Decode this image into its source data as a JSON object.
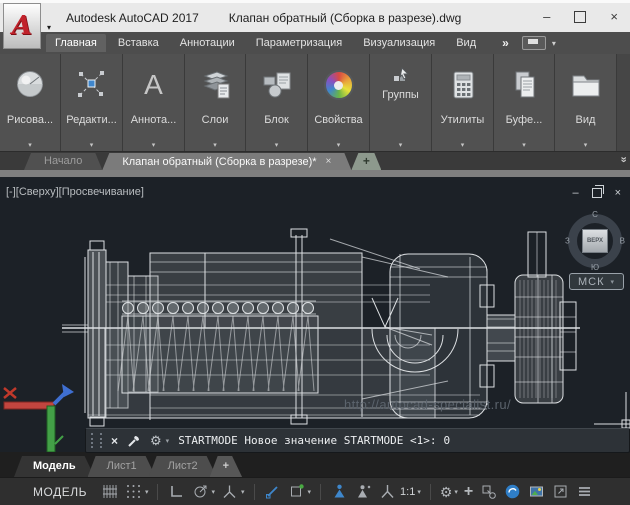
{
  "window": {
    "app_title": "Autodesk AutoCAD 2017",
    "doc_title": "Клапан обратный (Сборка в разрезе).dwg",
    "logo_letter": "A"
  },
  "glyphs": {
    "caret": "▾",
    "minimize": "–",
    "close": "×",
    "overflow": "»",
    "plus": "+",
    "gear": "⚙",
    "annotate_letter": "А",
    "chevrons": "»"
  },
  "ribbon": {
    "tabs": [
      {
        "label": "Главная",
        "active": true
      },
      {
        "label": "Вставка"
      },
      {
        "label": "Аннотации"
      },
      {
        "label": "Параметризация"
      },
      {
        "label": "Визуализация"
      },
      {
        "label": "Вид"
      }
    ],
    "panels": [
      {
        "label": "Рисова...",
        "icon": "draw-sphere-icon"
      },
      {
        "label": "Редакти...",
        "icon": "modify-icon"
      },
      {
        "label": "Аннота...",
        "icon": "annotation-letter-icon"
      },
      {
        "label": "Слои",
        "icon": "layers-icon"
      },
      {
        "label": "Блок",
        "icon": "block-icon"
      },
      {
        "label": "Свойства",
        "icon": "properties-colorwheel-icon"
      },
      {
        "label": "Группы",
        "icon": "groups-cursor-icon"
      },
      {
        "label": "Утилиты",
        "icon": "utilities-calculator-icon"
      },
      {
        "label": "Буфе...",
        "icon": "clipboard-icon"
      },
      {
        "label": "Вид",
        "icon": "view-folder-icon"
      }
    ]
  },
  "file_tabs": {
    "start_tab": "Начало",
    "active_tab": "Клапан обратный (Сборка в разрезе)*"
  },
  "viewport": {
    "control_minus": "[-]",
    "control_view": "[Сверху]",
    "control_style": "[Просвечивание]",
    "viewcube": {
      "north": "С",
      "east": "В",
      "south": "Ю",
      "west": "З",
      "top_label": "ВЕРХ"
    },
    "ucs_button_label": "МСК",
    "watermark": "http://autocad-specialist.ru/"
  },
  "command_line": {
    "prompt": "STARTMODE Новое значение STARTMODE <1>:",
    "value": "0"
  },
  "layout_tabs": {
    "model": "Модель",
    "sheet1": "Лист1",
    "sheet2": "Лист2",
    "add": "+"
  },
  "status_bar": {
    "model_label": "МОДЕЛЬ",
    "annotation_scale": "1:1"
  },
  "icons": {
    "grid-display-icon": "grid-lines",
    "snap-mode-icon": "dotted-grid",
    "ortho-mode-icon": "L-angle",
    "polar-tracking-icon": "circle-with-ray",
    "isometric-drafting-icon": "tripod",
    "object-snap-tracking-icon": "blue-diagonal",
    "object-snap-icon": "square-green-dot",
    "annotation-visibility-icon": "blue-person",
    "autoscale-icon": "gray-person",
    "annotation-scale-icon": "tripod-arrows",
    "workspace-gear-icon": "gear",
    "hardware-acceleration-icon": "blue-disc",
    "customization-menu-icon": "hamburger"
  },
  "colors": {
    "canvas_bg": "#1c2127",
    "logo_red": "#c1222b",
    "accent_blue": "#3e87cc",
    "wire": "#eef1f3"
  }
}
